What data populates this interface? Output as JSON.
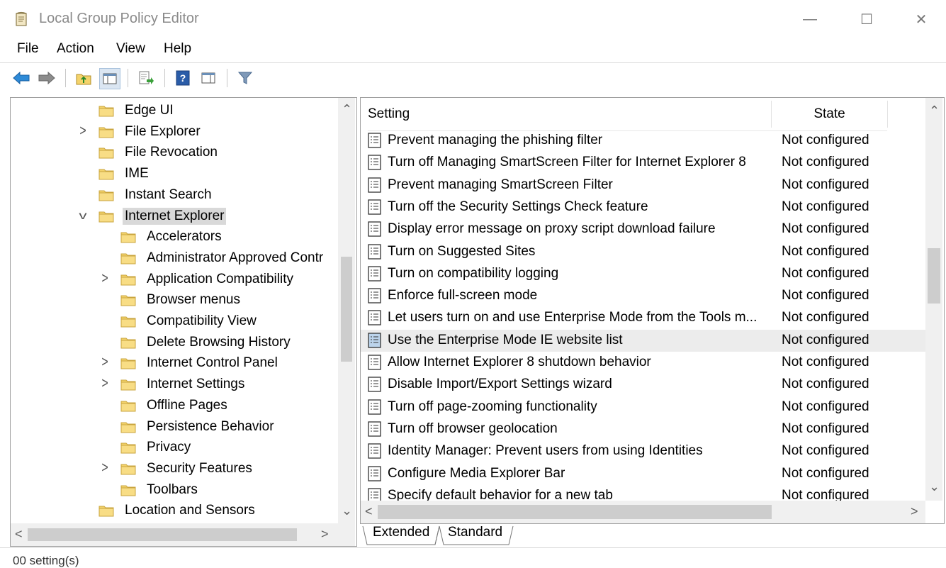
{
  "window": {
    "title": "Local Group Policy Editor",
    "minimize_glyph": "—",
    "maximize_glyph": "☐",
    "close_glyph": "✕"
  },
  "menu": [
    "File",
    "Action",
    "View",
    "Help"
  ],
  "toolbar": {
    "icons": [
      "back-arrow-icon",
      "forward-arrow-icon",
      "up-folder-icon",
      "show-hide-tree-icon",
      "export-list-icon",
      "help-icon",
      "show-hide-action-pane-icon",
      "filter-icon"
    ]
  },
  "tree": {
    "items": [
      {
        "label": "Edge UI",
        "level": 0,
        "expander": ""
      },
      {
        "label": "File Explorer",
        "level": 0,
        "expander": ">"
      },
      {
        "label": "File Revocation",
        "level": 0,
        "expander": ""
      },
      {
        "label": "IME",
        "level": 0,
        "expander": ""
      },
      {
        "label": "Instant Search",
        "level": 0,
        "expander": ""
      },
      {
        "label": "Internet Explorer",
        "level": 0,
        "expander": "v",
        "selected": true
      },
      {
        "label": "Accelerators",
        "level": 1,
        "expander": ""
      },
      {
        "label": "Administrator Approved Contr",
        "level": 1,
        "expander": ""
      },
      {
        "label": "Application Compatibility",
        "level": 1,
        "expander": ">"
      },
      {
        "label": "Browser menus",
        "level": 1,
        "expander": ""
      },
      {
        "label": "Compatibility View",
        "level": 1,
        "expander": ""
      },
      {
        "label": "Delete Browsing History",
        "level": 1,
        "expander": ""
      },
      {
        "label": "Internet Control Panel",
        "level": 1,
        "expander": ">"
      },
      {
        "label": "Internet Settings",
        "level": 1,
        "expander": ">"
      },
      {
        "label": "Offline Pages",
        "level": 1,
        "expander": ""
      },
      {
        "label": "Persistence Behavior",
        "level": 1,
        "expander": ""
      },
      {
        "label": "Privacy",
        "level": 1,
        "expander": ""
      },
      {
        "label": "Security Features",
        "level": 1,
        "expander": ">"
      },
      {
        "label": "Toolbars",
        "level": 1,
        "expander": ""
      },
      {
        "label": "Location and Sensors",
        "level": 0,
        "expander": ""
      }
    ]
  },
  "list": {
    "columns": {
      "setting": "Setting",
      "state": "State"
    },
    "rows": [
      {
        "setting": "Prevent managing the phishing filter",
        "state": "Not configured"
      },
      {
        "setting": "Turn off Managing SmartScreen Filter for Internet Explorer 8",
        "state": "Not configured"
      },
      {
        "setting": "Prevent managing SmartScreen Filter",
        "state": "Not configured"
      },
      {
        "setting": "Turn off the Security Settings Check feature",
        "state": "Not configured"
      },
      {
        "setting": "Display error message on proxy script download failure",
        "state": "Not configured"
      },
      {
        "setting": "Turn on Suggested Sites",
        "state": "Not configured"
      },
      {
        "setting": "Turn on compatibility logging",
        "state": "Not configured"
      },
      {
        "setting": "Enforce full-screen mode",
        "state": "Not configured"
      },
      {
        "setting": "Let users turn on and use Enterprise Mode from the Tools m...",
        "state": "Not configured"
      },
      {
        "setting": "Use the Enterprise Mode IE website list",
        "state": "Not configured",
        "selected": true
      },
      {
        "setting": "Allow Internet Explorer 8 shutdown behavior",
        "state": "Not configured"
      },
      {
        "setting": "Disable Import/Export Settings wizard",
        "state": "Not configured"
      },
      {
        "setting": "Turn off page-zooming functionality",
        "state": "Not configured"
      },
      {
        "setting": "Turn off browser geolocation",
        "state": "Not configured"
      },
      {
        "setting": "Identity Manager: Prevent users from using Identities",
        "state": "Not configured"
      },
      {
        "setting": "Configure Media Explorer Bar",
        "state": "Not configured"
      },
      {
        "setting": "Specify default behavior for a new tab",
        "state": "Not configured"
      }
    ]
  },
  "tabs": [
    "Extended",
    "Standard"
  ],
  "status": {
    "text": "00 setting(s)"
  },
  "colors": {
    "selection": "#d9d9d9",
    "folder": "#f4d36b",
    "border": "#a0a0a0"
  }
}
